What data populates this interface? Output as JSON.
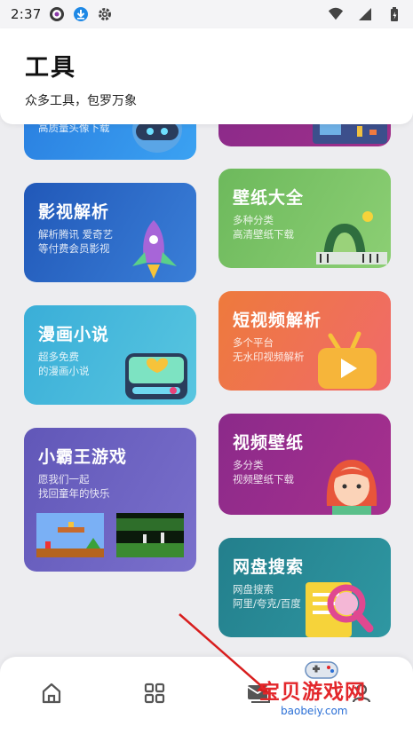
{
  "status_bar": {
    "time": "2:37",
    "icons": [
      "app-notification-icon",
      "download-icon",
      "settings-icon",
      "wifi-icon",
      "signal-icon",
      "battery-icon"
    ]
  },
  "header": {
    "title": "工具",
    "subtitle": "众多工具，包罗万象"
  },
  "cards": [
    {
      "id": "partial-left",
      "title": "",
      "desc": [
        "高质量头像下载"
      ],
      "color": "#2f8ae8"
    },
    {
      "id": "partial-right",
      "title": "",
      "desc": [],
      "color": "#9b2a8a"
    },
    {
      "id": "video-parse",
      "title": "影视解析",
      "desc": [
        "解析腾讯 爱奇艺",
        "等付费会员影视"
      ],
      "color": "#2d67c4"
    },
    {
      "id": "wallpaper",
      "title": "壁纸大全",
      "desc": [
        "多种分类",
        "高清壁纸下载"
      ],
      "color": "#7cc364"
    },
    {
      "id": "comics",
      "title": "漫画小说",
      "desc": [
        "超多免费",
        "的漫画小说"
      ],
      "color": "#41b7d8"
    },
    {
      "id": "short-video",
      "title": "短视频解析",
      "desc": [
        "多个平台",
        "无水印视频解析"
      ],
      "color": "#ee7b4c"
    },
    {
      "id": "nes-games",
      "title": "小霸王游戏",
      "desc": [
        "愿我们一起",
        "找回童年的快乐"
      ],
      "color": "#6c64c0"
    },
    {
      "id": "video-wallpaper",
      "title": "视频壁纸",
      "desc": [
        "多分类",
        "视频壁纸下载"
      ],
      "color": "#9a2d8c"
    },
    {
      "id": "netdisk",
      "title": "网盘搜索",
      "desc": [
        "网盘搜索",
        "阿里/夸克/百度"
      ],
      "color": "#2a8a96"
    }
  ],
  "bottom_nav": [
    {
      "icon": "home-icon"
    },
    {
      "icon": "grid-icon"
    },
    {
      "icon": "inbox-icon"
    },
    {
      "icon": "profile-icon"
    }
  ],
  "watermark": {
    "text": "宝贝游戏网",
    "url": "baobeiy.com"
  }
}
